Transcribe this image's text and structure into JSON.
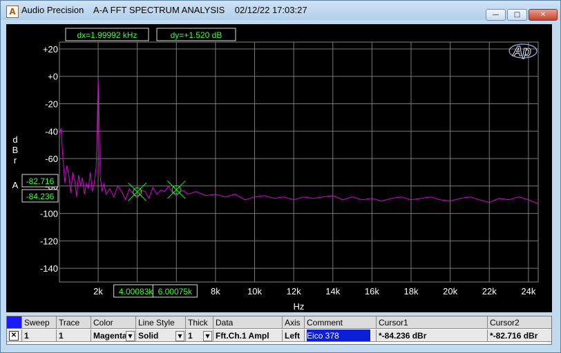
{
  "window": {
    "title": "Audio Precision    A-A FFT SPECTRUM ANALYSIS    02/12/22 17:03:27",
    "buttons": {
      "minimize": "—",
      "maximize": "□",
      "close": "✕"
    }
  },
  "readouts": {
    "dx": "dx=1.99992 kHz",
    "dy": "dy=+1.520  dB"
  },
  "logo": "Ap",
  "chart_data": {
    "type": "line",
    "title": "",
    "xlabel": "Hz",
    "ylabel_letters": [
      "d",
      "B",
      "r"
    ],
    "channel_label": "A",
    "xlim": [
      20,
      24500
    ],
    "ylim": [
      -150,
      25
    ],
    "x_ticks": [
      {
        "v": 2000,
        "label": "2k"
      },
      {
        "v": 4000,
        "label": "4k"
      },
      {
        "v": 6000,
        "label": "6k"
      },
      {
        "v": 8000,
        "label": "8k"
      },
      {
        "v": 10000,
        "label": "10k"
      },
      {
        "v": 12000,
        "label": "12k"
      },
      {
        "v": 14000,
        "label": "14k"
      },
      {
        "v": 16000,
        "label": "16k"
      },
      {
        "v": 18000,
        "label": "18k"
      },
      {
        "v": 20000,
        "label": "20k"
      },
      {
        "v": 22000,
        "label": "22k"
      },
      {
        "v": 24000,
        "label": "24k"
      }
    ],
    "y_ticks": [
      {
        "v": 20,
        "label": "+20"
      },
      {
        "v": 0,
        "label": "+0"
      },
      {
        "v": -20,
        "label": "-20"
      },
      {
        "v": -40,
        "label": "-40"
      },
      {
        "v": -60,
        "label": "-60"
      },
      {
        "v": -80,
        "label": "-80"
      },
      {
        "v": -100,
        "label": "-100"
      },
      {
        "v": -120,
        "label": "-120"
      },
      {
        "v": -140,
        "label": "-140"
      }
    ],
    "grid": true,
    "series": [
      {
        "color": "#e000e0",
        "x": [
          20,
          100,
          200,
          300,
          400,
          500,
          600,
          700,
          800,
          900,
          1000,
          1100,
          1200,
          1300,
          1400,
          1500,
          1600,
          1700,
          1800,
          1900,
          1950,
          2000,
          2050,
          2100,
          2200,
          2300,
          2400,
          2600,
          2800,
          3000,
          3200,
          3400,
          3600,
          3800,
          4000,
          4200,
          4400,
          4600,
          4800,
          5000,
          5200,
          5400,
          5600,
          5800,
          6000,
          6300,
          6600,
          7000,
          7500,
          8000,
          8500,
          9000,
          9500,
          10000,
          10500,
          11000,
          11500,
          12000,
          12500,
          13000,
          13500,
          14000,
          14500,
          15000,
          15500,
          16000,
          16500,
          17000,
          17500,
          18000,
          18500,
          19000,
          19500,
          20000,
          20500,
          21000,
          21500,
          22000,
          22500,
          23000,
          23500,
          24000,
          24500
        ],
        "y": [
          -42,
          -38,
          -60,
          -78,
          -65,
          -72,
          -85,
          -70,
          -76,
          -88,
          -72,
          -80,
          -74,
          -86,
          -78,
          -82,
          -70,
          -84,
          -78,
          -66,
          -40,
          -2,
          -30,
          -72,
          -84,
          -78,
          -86,
          -82,
          -88,
          -80,
          -84,
          -90,
          -82,
          -86,
          -89,
          -83,
          -84,
          -89,
          -81,
          -86,
          -83,
          -84,
          -80,
          -85,
          -87,
          -83,
          -86,
          -84,
          -87,
          -86,
          -88,
          -86,
          -90,
          -88,
          -87,
          -89,
          -88,
          -90,
          -88,
          -89,
          -88,
          -87,
          -90,
          -88,
          -90,
          -89,
          -91,
          -89,
          -88,
          -90,
          -89,
          -88,
          -90,
          -91,
          -89,
          -88,
          -90,
          -92,
          -89,
          -90,
          -88,
          -90,
          -93
        ]
      }
    ],
    "cursors": [
      {
        "x": 4000.83,
        "y": -84.236,
        "x_label": "4.00083k",
        "y_label": "-84.236"
      },
      {
        "x": 6000.75,
        "y": -82.716,
        "x_label": "6.00075k",
        "y_label": "-82.716"
      }
    ]
  },
  "table": {
    "headers": [
      "Sweep",
      "Trace",
      "Color",
      "Line Style",
      "Thick",
      "Data",
      "Axis",
      "Comment",
      "Cursor1",
      "Cursor2"
    ],
    "row": {
      "checkbox": "✕",
      "sweep": "1",
      "trace": "1",
      "color": "Magenta",
      "line_style": "Solid",
      "thick": "1",
      "data": "Fft.Ch.1 Ampl",
      "axis": "Left",
      "comment": "Eico 378",
      "cursor1": "*-84.236  dBr",
      "cursor2": "*-82.716  dBr"
    }
  }
}
